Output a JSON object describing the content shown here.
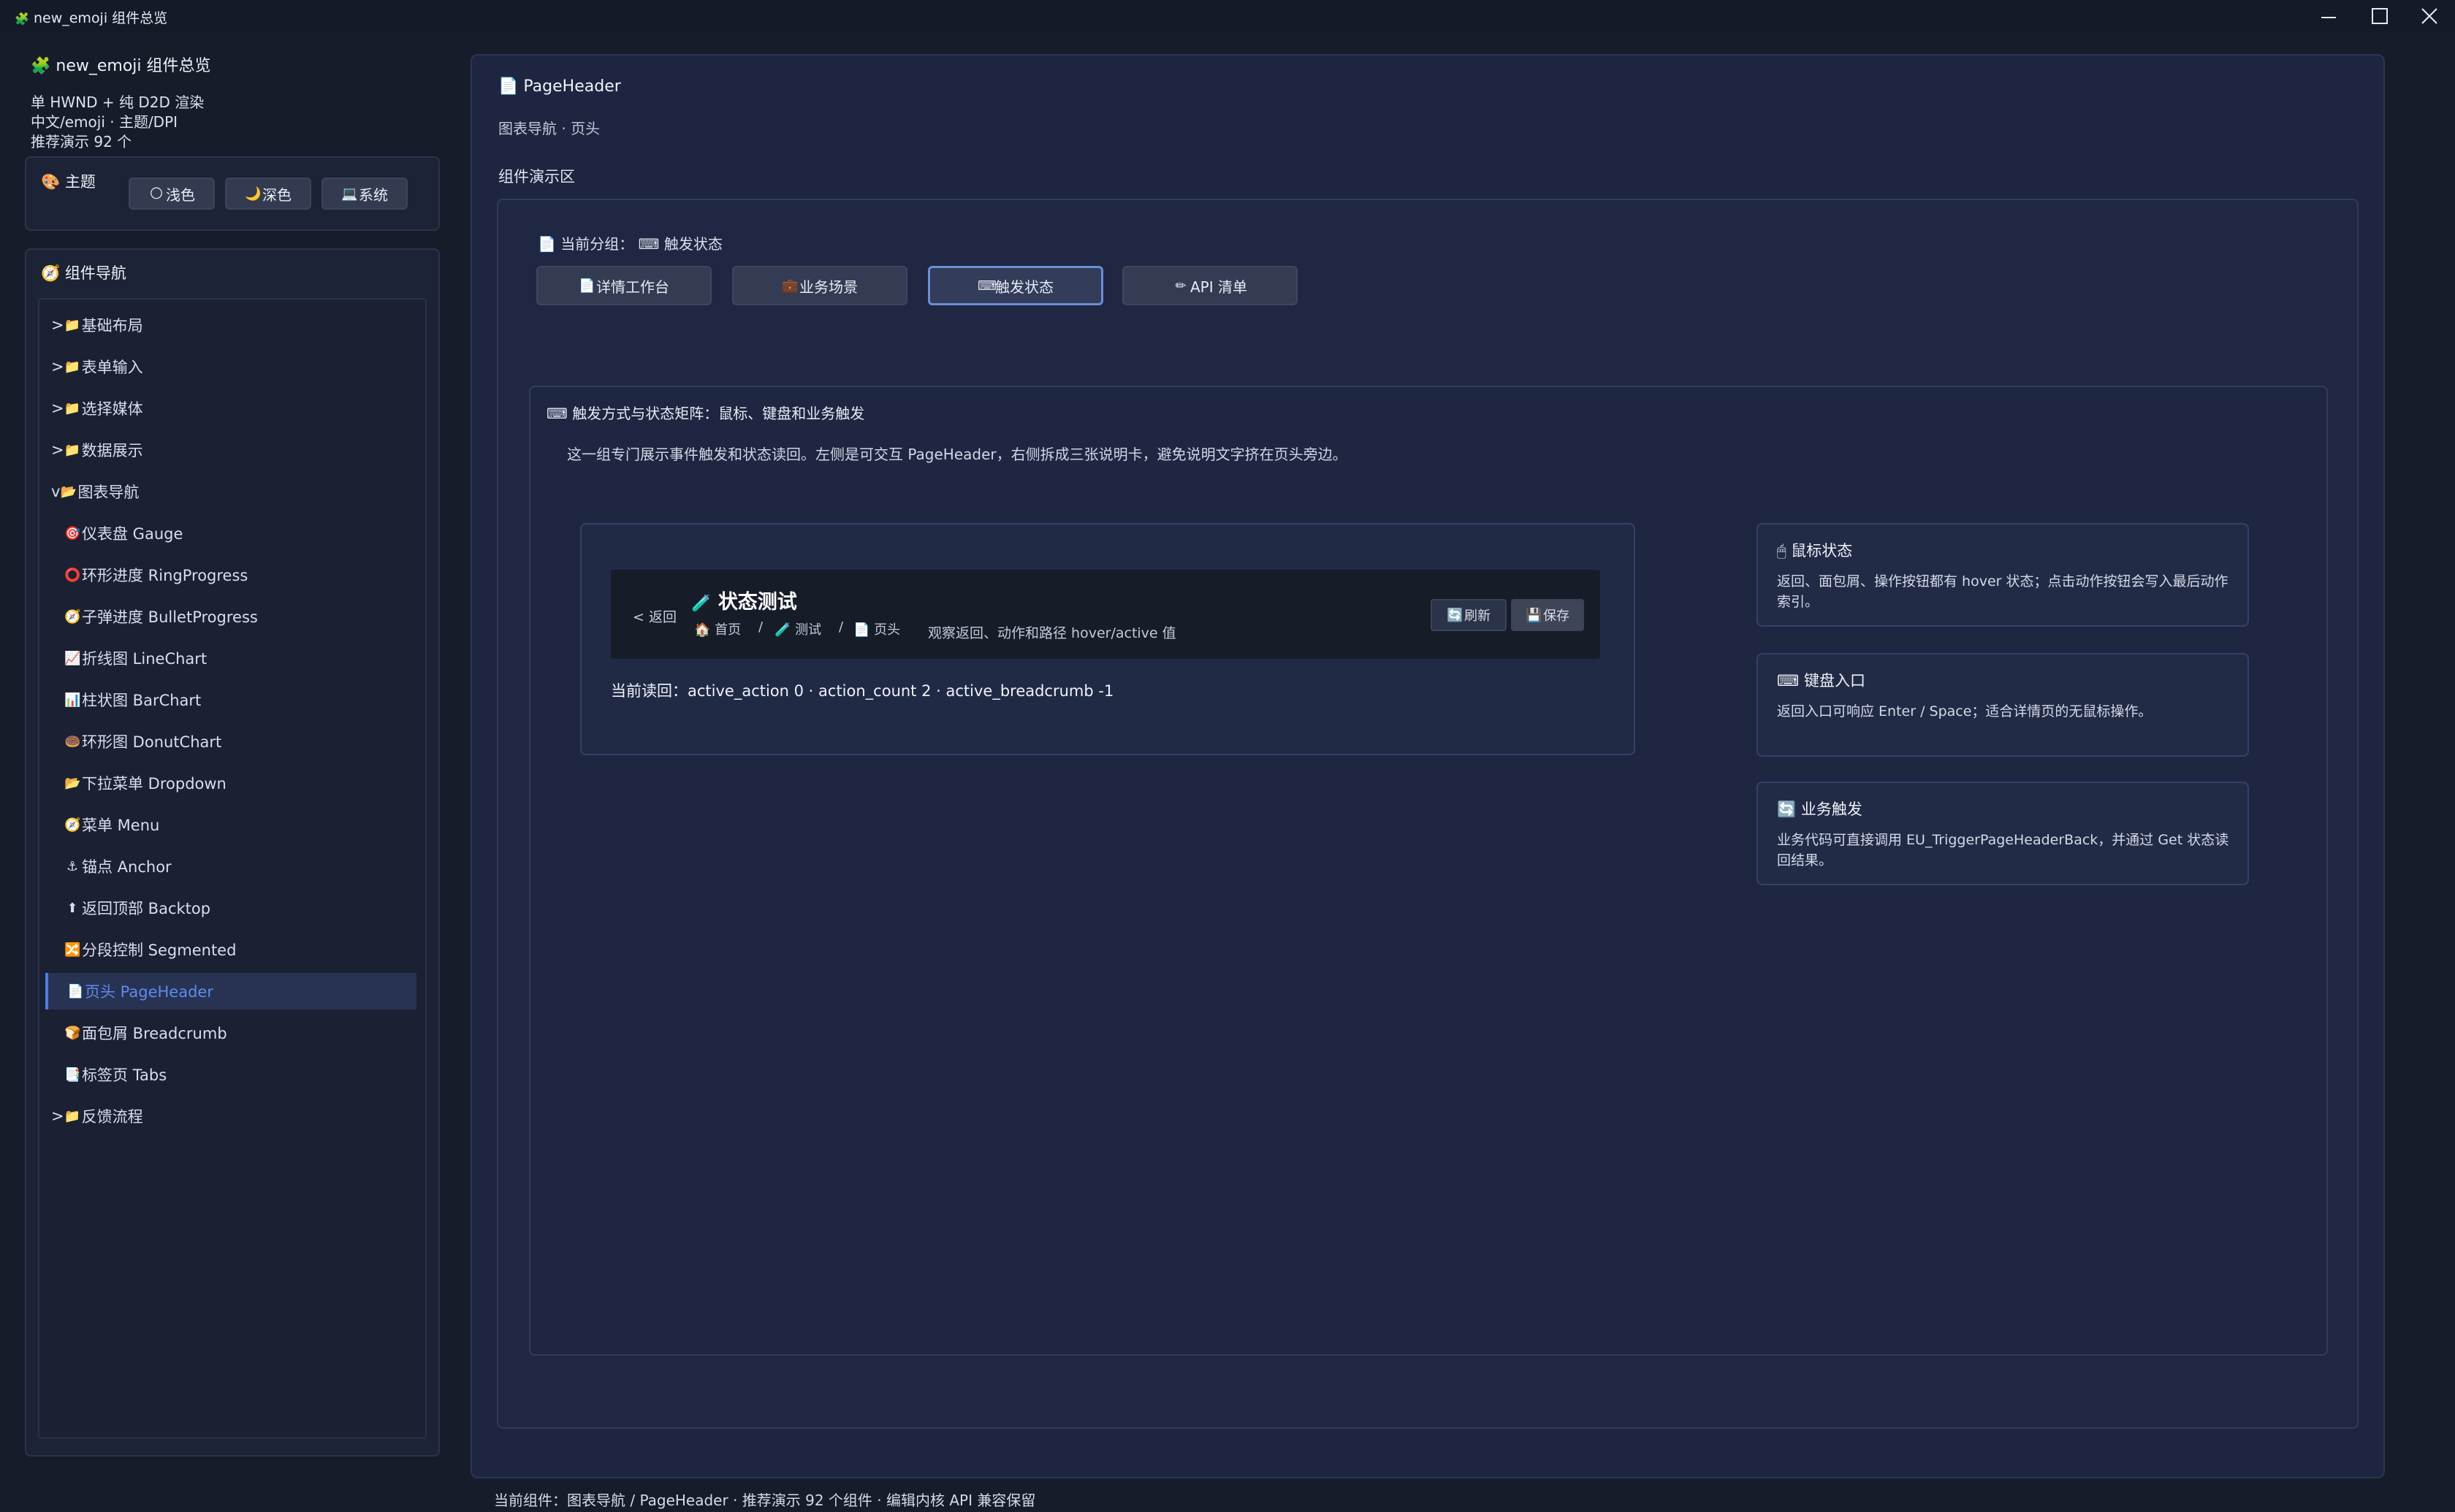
{
  "window": {
    "title": "new_emoji 组件总览",
    "icon": "🧩"
  },
  "sidebar": {
    "app_title": "new_emoji 组件总览",
    "info": [
      "单 HWND + 纯 D2D 渲染",
      "中文/emoji · 主题/DPI",
      "推荐演示 92 个"
    ],
    "theme": {
      "label": "主题",
      "icon": "🎨",
      "buttons": [
        {
          "icon": "🌕",
          "label": "浅色"
        },
        {
          "icon": "🌙",
          "label": "深色"
        },
        {
          "icon": "💻",
          "label": "系统"
        }
      ]
    },
    "nav": {
      "title": "组件导航",
      "icon": "🧭",
      "items": [
        {
          "prefix": ">",
          "icon": "📁",
          "label": "基础布局"
        },
        {
          "prefix": ">",
          "icon": "📁",
          "label": "表单输入"
        },
        {
          "prefix": ">",
          "icon": "📁",
          "label": "选择媒体"
        },
        {
          "prefix": ">",
          "icon": "📁",
          "label": "数据展示"
        },
        {
          "prefix": "v",
          "icon": "📂",
          "label": "图表导航"
        },
        {
          "icon": "🎯",
          "label": "仪表盘 Gauge"
        },
        {
          "icon": "⭕",
          "label": "环形进度 RingProgress"
        },
        {
          "icon": "🧭",
          "label": "子弹进度 BulletProgress"
        },
        {
          "icon": "📈",
          "label": "折线图 LineChart"
        },
        {
          "icon": "📊",
          "label": "柱状图 BarChart"
        },
        {
          "icon": "🍩",
          "label": "环形图 DonutChart"
        },
        {
          "icon": "📂",
          "label": "下拉菜单 Dropdown"
        },
        {
          "icon": "🧭",
          "label": "菜单 Menu"
        },
        {
          "icon": "⚓",
          "label": "锚点 Anchor"
        },
        {
          "icon": "⬆",
          "label": "返回顶部 Backtop"
        },
        {
          "icon": "🔀",
          "label": "分段控制 Segmented"
        },
        {
          "icon": "📄",
          "label": "页头 PageHeader"
        },
        {
          "icon": "🍞",
          "label": "面包屑 Breadcrumb"
        },
        {
          "icon": "📑",
          "label": "标签页 Tabs"
        },
        {
          "prefix": ">",
          "icon": "📁",
          "label": "反馈流程"
        }
      ]
    }
  },
  "main": {
    "header_icon": "📄",
    "title": "PageHeader",
    "subtitle": "图表导航 · 页头",
    "demo_label": "组件演示区",
    "group_prefix": "当前分组：",
    "group_value": "触发状态",
    "group_icon": "📄",
    "group_value_icon": "⌨",
    "tabs": [
      {
        "icon": "📄",
        "label": "详情工作台"
      },
      {
        "icon": "💼",
        "label": "业务场景"
      },
      {
        "icon": "⌨",
        "label": "触发状态"
      },
      {
        "icon": "✏",
        "label": "API 清单"
      }
    ],
    "active_tab": 2,
    "matrix": {
      "icon": "⌨",
      "title": "触发方式与状态矩阵：鼠标、键盘和业务触发",
      "desc": "这一组专门展示事件触发和状态读回。左侧是可交互 PageHeader，右侧拆成三张说明卡，避免说明文字挤在页头旁边。"
    },
    "page_header_demo": {
      "back": "< 返回",
      "title_icon": "🧪",
      "title": "状态测试",
      "breadcrumb": [
        {
          "icon": "🏠",
          "label": "首页"
        },
        {
          "icon": "🧪",
          "label": "测试"
        },
        {
          "icon": "📄",
          "label": "页头"
        }
      ],
      "separator": "/",
      "observe": "观察返回、动作和路径 hover/active 值",
      "actions": [
        {
          "icon": "🔄",
          "label": "刷新"
        },
        {
          "icon": "💾",
          "label": "保存"
        }
      ],
      "readback": "当前读回：active_action 0 · action_count 2 · active_breadcrumb -1"
    },
    "cards": [
      {
        "icon": "🖱",
        "title": "鼠标状态",
        "text": "返回、面包屑、操作按钮都有 hover 状态；点击动作按钮会写入最后动作索引。"
      },
      {
        "icon": "⌨",
        "title": "键盘入口",
        "text": "返回入口可响应 Enter / Space；适合详情页的无鼠标操作。"
      },
      {
        "icon": "🔄",
        "title": "业务触发",
        "text": "业务代码可直接调用 EU_TriggerPageHeaderBack，并通过 Get 状态读回结果。"
      }
    ]
  },
  "status_bar": "当前组件：图表导航 / PageHeader · 推荐演示 92 个组件 · 编辑内核 API 兼容保留",
  "colors": {
    "background": "#171c2b",
    "panel": "#1d2336",
    "accent": "#5c8cf0",
    "active_border": "#6a8ed8"
  }
}
